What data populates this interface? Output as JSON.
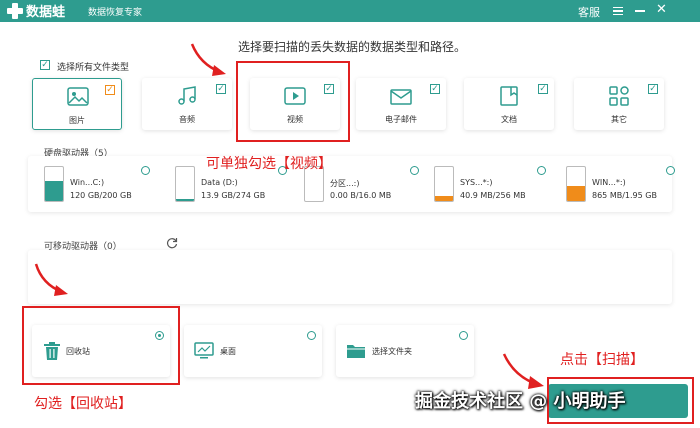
{
  "app": {
    "name": "数据蛙",
    "subtitle": "数据恢复专家"
  },
  "titlebar": {
    "service": "客服",
    "minimize": "—",
    "close": "✕"
  },
  "main_title": "选择要扫描的丢失数据的数据类型和路径。",
  "select_all": {
    "label": "选择所有文件类型",
    "checked": true
  },
  "file_types": [
    {
      "label": "图片",
      "icon": "image-icon",
      "checked": true
    },
    {
      "label": "音频",
      "icon": "music-icon",
      "checked": true
    },
    {
      "label": "视频",
      "icon": "video-icon",
      "checked": true
    },
    {
      "label": "电子邮件",
      "icon": "mail-icon",
      "checked": true
    },
    {
      "label": "文档",
      "icon": "document-icon",
      "checked": true
    },
    {
      "label": "其它",
      "icon": "other-icon",
      "checked": true
    }
  ],
  "hard_drives": {
    "label": "硬盘驱动器（5）",
    "items": [
      {
        "name": "Win...C:)",
        "size": "120 GB/200 GB",
        "fill_color": "#2e9c8f",
        "used_fraction": 0.6
      },
      {
        "name": "Data (D:)",
        "size": "13.9 GB/274 GB",
        "fill_color": "#2e9c8f",
        "used_fraction": 0.05
      },
      {
        "name": "分区...:)",
        "size": "0.00  B/16.0 MB",
        "fill_color": "#2e9c8f",
        "used_fraction": 0
      },
      {
        "name": "SYS...*:)",
        "size": "40.9 MB/256 MB",
        "fill_color": "#f08c1a",
        "used_fraction": 0.16
      },
      {
        "name": "WIN...*:)",
        "size": "865 MB/1.95 GB",
        "fill_color": "#f08c1a",
        "used_fraction": 0.44
      }
    ]
  },
  "removable": {
    "label": "可移动驱动器（0）"
  },
  "locations": [
    {
      "label": "回收站",
      "icon": "trash-icon",
      "selected": true
    },
    {
      "label": "桌面",
      "icon": "desktop-icon",
      "selected": false
    },
    {
      "label": "选择文件夹",
      "icon": "folder-icon",
      "selected": false
    }
  ],
  "annotations": {
    "video": "可单独勾选【视频】",
    "recycle": "勾选【回收站】",
    "scan": "点击【扫描】"
  },
  "watermark": "掘金技术社区 @ 小明助手",
  "colors": {
    "accent": "#2e9c8f",
    "annotation": "#e02020",
    "warn": "#f08c1a"
  }
}
